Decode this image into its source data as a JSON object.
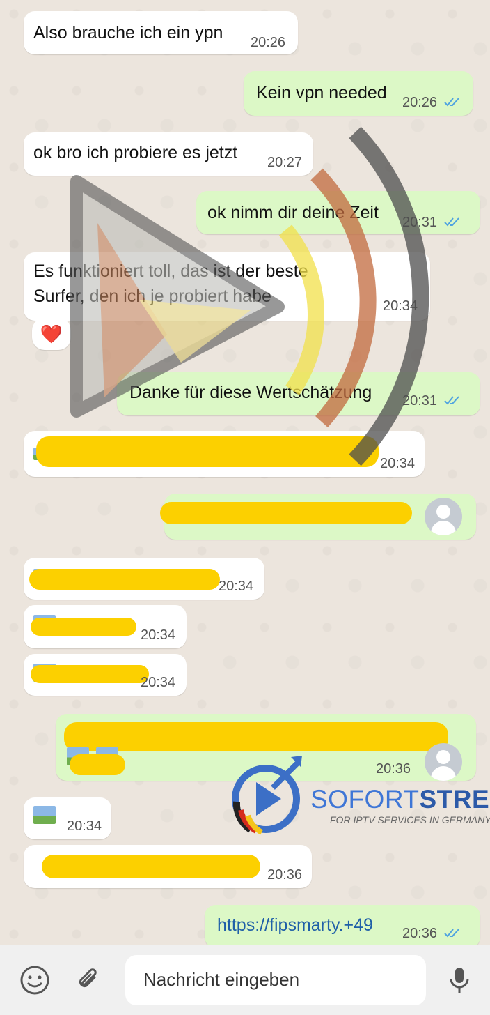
{
  "messages": [
    {
      "id": "m1",
      "dir": "in",
      "text": "Also brauche ich ein ypn",
      "time": "20:26"
    },
    {
      "id": "m2",
      "dir": "out",
      "text": "Kein vpn needed",
      "time": "20:26"
    },
    {
      "id": "m3",
      "dir": "in",
      "text": "ok bro ich probiere es jetzt",
      "time": "20:27"
    },
    {
      "id": "m4",
      "dir": "out",
      "text": "ok nimm dir deine Zeit",
      "time": "20:31"
    },
    {
      "id": "m5",
      "dir": "in",
      "text_line1": "Es funktioniert toll, das ist der beste",
      "text_line2": "Surfer, den ich je probiert habe",
      "time": "20:34",
      "reaction": "❤️"
    },
    {
      "id": "m6",
      "dir": "out",
      "text": "Danke für diese Wertschätzung",
      "time": "20:31"
    },
    {
      "id": "m7",
      "dir": "in",
      "time": "20:34"
    },
    {
      "id": "m8",
      "dir": "out"
    },
    {
      "id": "m9",
      "dir": "in",
      "time": "20:34"
    },
    {
      "id": "m10",
      "dir": "in",
      "time": "20:34"
    },
    {
      "id": "m11",
      "dir": "in",
      "time": "20:34"
    },
    {
      "id": "m12",
      "dir": "out",
      "time": "20:36"
    },
    {
      "id": "m13",
      "dir": "in",
      "time": "20:34"
    },
    {
      "id": "m14",
      "dir": "in",
      "time": "20:36"
    },
    {
      "id": "m15",
      "dir": "out",
      "text": "https://fipsmarty.+49",
      "time": "20:36"
    }
  ],
  "watermark": {
    "brand_part1": "SOFORT",
    "brand_part2": "STREAM",
    "tagline": "FOR IPTV SERVICES IN GERMANY"
  },
  "input_bar": {
    "placeholder": "Nachricht eingeben",
    "emoji_icon": "emoji-icon",
    "attach_icon": "paperclip-icon",
    "mic_icon": "microphone-icon"
  },
  "colors": {
    "background": "#ece5dd",
    "incoming_bubble": "#ffffff",
    "outgoing_bubble": "#dcf8c6",
    "read_ticks": "#4fa3e0",
    "redaction": "#fcd000",
    "link": "#1f5fa8"
  }
}
